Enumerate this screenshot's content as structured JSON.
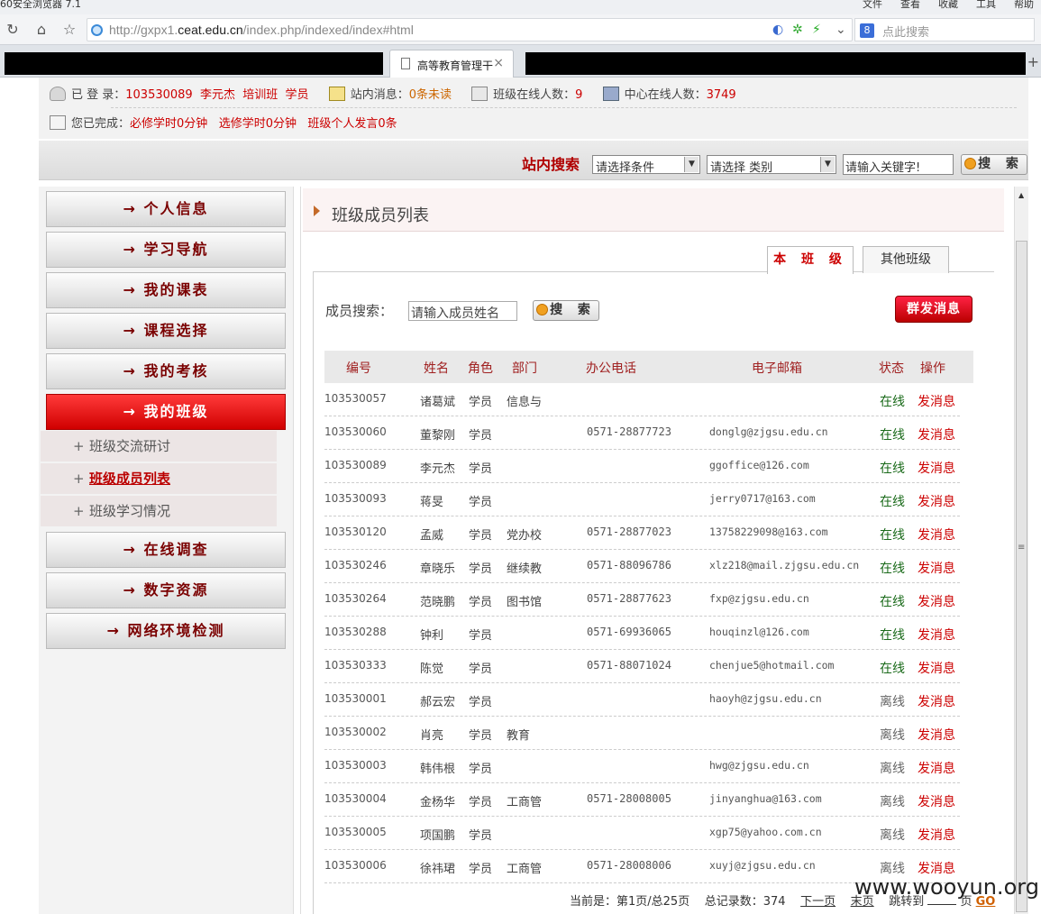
{
  "browser": {
    "title": "60安全浏览器 7.1",
    "menus": [
      "文件",
      "查看",
      "收藏",
      "工具",
      "帮助"
    ],
    "url_prefix": "http://gxpx1.",
    "url_domain": "ceat.edu.cn",
    "url_suffix": "/index.php/indexed/index#html",
    "search_placeholder": "点此搜索",
    "active_tab": "高等教育管理干",
    "engine_label": "8"
  },
  "info": {
    "login_label": "已 登 录：",
    "user_id": "103530089",
    "user_name": "李元杰",
    "class_name": "培训班",
    "user_role": "学员",
    "msg_label": "站内消息：",
    "msg_value": "0条未读",
    "class_online_label": "班级在线人数：",
    "class_online_value": "9",
    "center_online_label": "中心在线人数：",
    "center_online_value": "3749",
    "done_label": "您已完成：",
    "done_required": "必修学时0分钟",
    "done_elective": "选修学时0分钟",
    "done_speech": "班级个人发言0条"
  },
  "site_search": {
    "label": "站内搜索",
    "condition": "请选择条件",
    "category": "请选择 类别",
    "keyword": "请输入关键字!",
    "button": "搜 索"
  },
  "sidebar": {
    "items": [
      {
        "label": "→  个人信息"
      },
      {
        "label": "→  学习导航"
      },
      {
        "label": "→  我的课表"
      },
      {
        "label": "→  课程选择"
      },
      {
        "label": "→  我的考核"
      },
      {
        "label": "→  我的班级"
      },
      {
        "label": "→  在线调查"
      },
      {
        "label": "→  数字资源"
      },
      {
        "label": "→  网络环境检测"
      }
    ],
    "subitems": [
      {
        "label": "班级交流研讨"
      },
      {
        "label": "班级成员列表"
      },
      {
        "label": "班级学习情况"
      }
    ]
  },
  "main": {
    "title": "班级成员列表",
    "tab_this": "本 班 级",
    "tab_other": "其他班级",
    "member_search_label": "成员搜索：",
    "member_search_placeholder": "请输入成员姓名",
    "member_search_button": "搜 索",
    "broadcast_button": "群发消息",
    "columns": [
      "编号",
      "姓名",
      "角色",
      "部门",
      "办公电话",
      "电子邮箱",
      "状态",
      "操作"
    ],
    "rows": [
      {
        "id": "103530057",
        "name": "诸葛斌",
        "role": "学员",
        "dept": "信息与",
        "phone": "",
        "email": "",
        "status": "在线",
        "online": true,
        "op": "发消息"
      },
      {
        "id": "103530060",
        "name": "董黎刚",
        "role": "学员",
        "dept": "",
        "phone": "0571-28877723",
        "email": "donglg@zjgsu.edu.cn",
        "status": "在线",
        "online": true,
        "op": "发消息"
      },
      {
        "id": "103530089",
        "name": "李元杰",
        "role": "学员",
        "dept": "",
        "phone": "",
        "email": "ggoffice@126.com",
        "status": "在线",
        "online": true,
        "op": "发消息"
      },
      {
        "id": "103530093",
        "name": "蒋旻",
        "role": "学员",
        "dept": "",
        "phone": "",
        "email": "jerry0717@163.com",
        "status": "在线",
        "online": true,
        "op": "发消息"
      },
      {
        "id": "103530120",
        "name": "孟威",
        "role": "学员",
        "dept": "党办校",
        "phone": "0571-28877023",
        "email": "13758229098@163.com",
        "status": "在线",
        "online": true,
        "op": "发消息"
      },
      {
        "id": "103530246",
        "name": "章晓乐",
        "role": "学员",
        "dept": "继续教",
        "phone": "0571-88096786",
        "email": "xlz218@mail.zjgsu.edu.cn",
        "status": "在线",
        "online": true,
        "op": "发消息"
      },
      {
        "id": "103530264",
        "name": "范晓鹏",
        "role": "学员",
        "dept": "图书馆",
        "phone": "0571-28877623",
        "email": "fxp@zjgsu.edu.cn",
        "status": "在线",
        "online": true,
        "op": "发消息"
      },
      {
        "id": "103530288",
        "name": "钟利",
        "role": "学员",
        "dept": "",
        "phone": "0571-69936065",
        "email": "houqinzl@126.com",
        "status": "在线",
        "online": true,
        "op": "发消息"
      },
      {
        "id": "103530333",
        "name": "陈觉",
        "role": "学员",
        "dept": "",
        "phone": "0571-88071024",
        "email": "chenjue5@hotmail.com",
        "status": "在线",
        "online": true,
        "op": "发消息"
      },
      {
        "id": "103530001",
        "name": "郝云宏",
        "role": "学员",
        "dept": "",
        "phone": "",
        "email": "haoyh@zjgsu.edu.cn",
        "status": "离线",
        "online": false,
        "op": "发消息"
      },
      {
        "id": "103530002",
        "name": "肖亮",
        "role": "学员",
        "dept": "教育",
        "phone": "",
        "email": "",
        "status": "离线",
        "online": false,
        "op": "发消息"
      },
      {
        "id": "103530003",
        "name": "韩伟根",
        "role": "学员",
        "dept": "",
        "phone": "",
        "email": "hwg@zjgsu.edu.cn",
        "status": "离线",
        "online": false,
        "op": "发消息"
      },
      {
        "id": "103530004",
        "name": "金杨华",
        "role": "学员",
        "dept": "工商管",
        "phone": "0571-28008005",
        "email": "jinyanghua@163.com",
        "status": "离线",
        "online": false,
        "op": "发消息"
      },
      {
        "id": "103530005",
        "name": "项国鹏",
        "role": "学员",
        "dept": "",
        "phone": "",
        "email": "xgp75@yahoo.com.cn",
        "status": "离线",
        "online": false,
        "op": "发消息"
      },
      {
        "id": "103530006",
        "name": "徐祎珺",
        "role": "学员",
        "dept": "工商管",
        "phone": "0571-28008006",
        "email": "xuyj@zjgsu.edu.cn",
        "status": "离线",
        "online": false,
        "op": "发消息"
      }
    ]
  },
  "pager": {
    "current": "当前是：第1页/总25页",
    "total": "总记录数：374",
    "next": "下一页",
    "last": "末页",
    "jump": "跳转到",
    "page_unit": "页",
    "go": "GO"
  },
  "watermark": "www.wooyun.org"
}
